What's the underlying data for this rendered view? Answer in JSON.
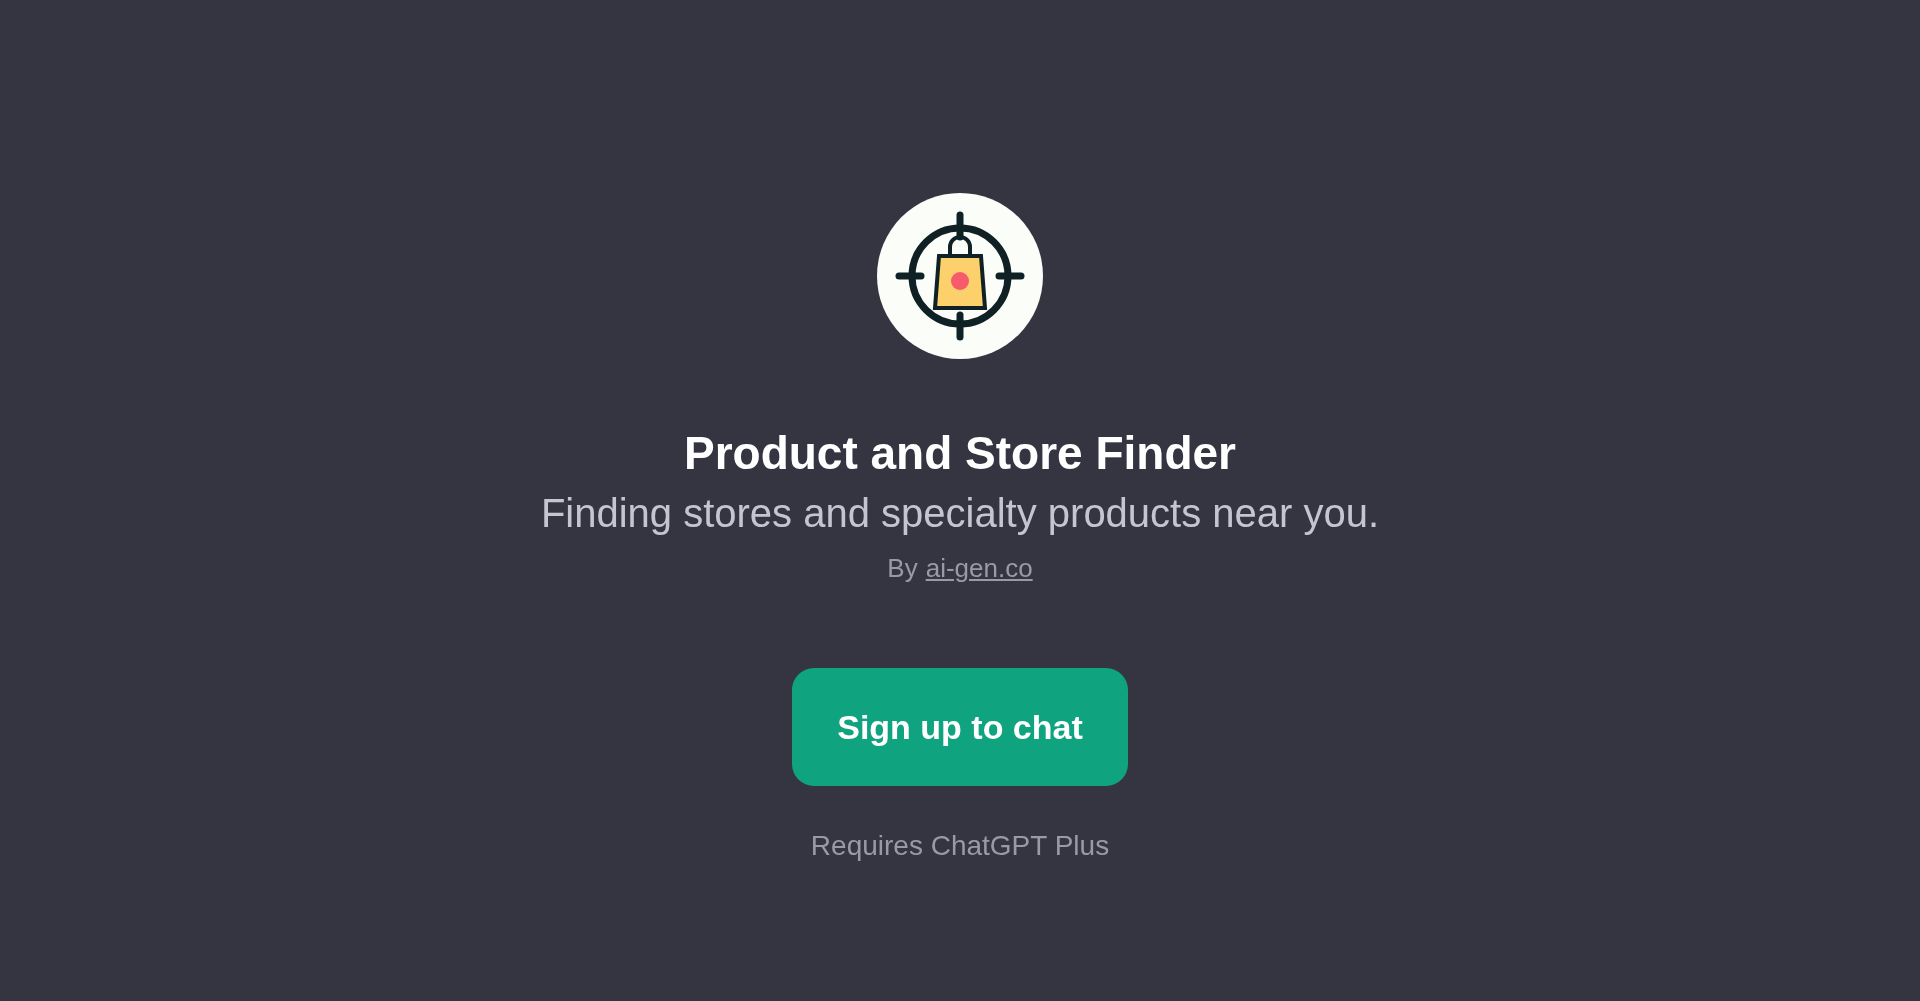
{
  "title": "Product and Store Finder",
  "description": "Finding stores and specialty products near you.",
  "author": {
    "prefix": "By",
    "link": "ai-gen.co"
  },
  "button": "Sign up to chat",
  "note": "Requires ChatGPT Plus"
}
